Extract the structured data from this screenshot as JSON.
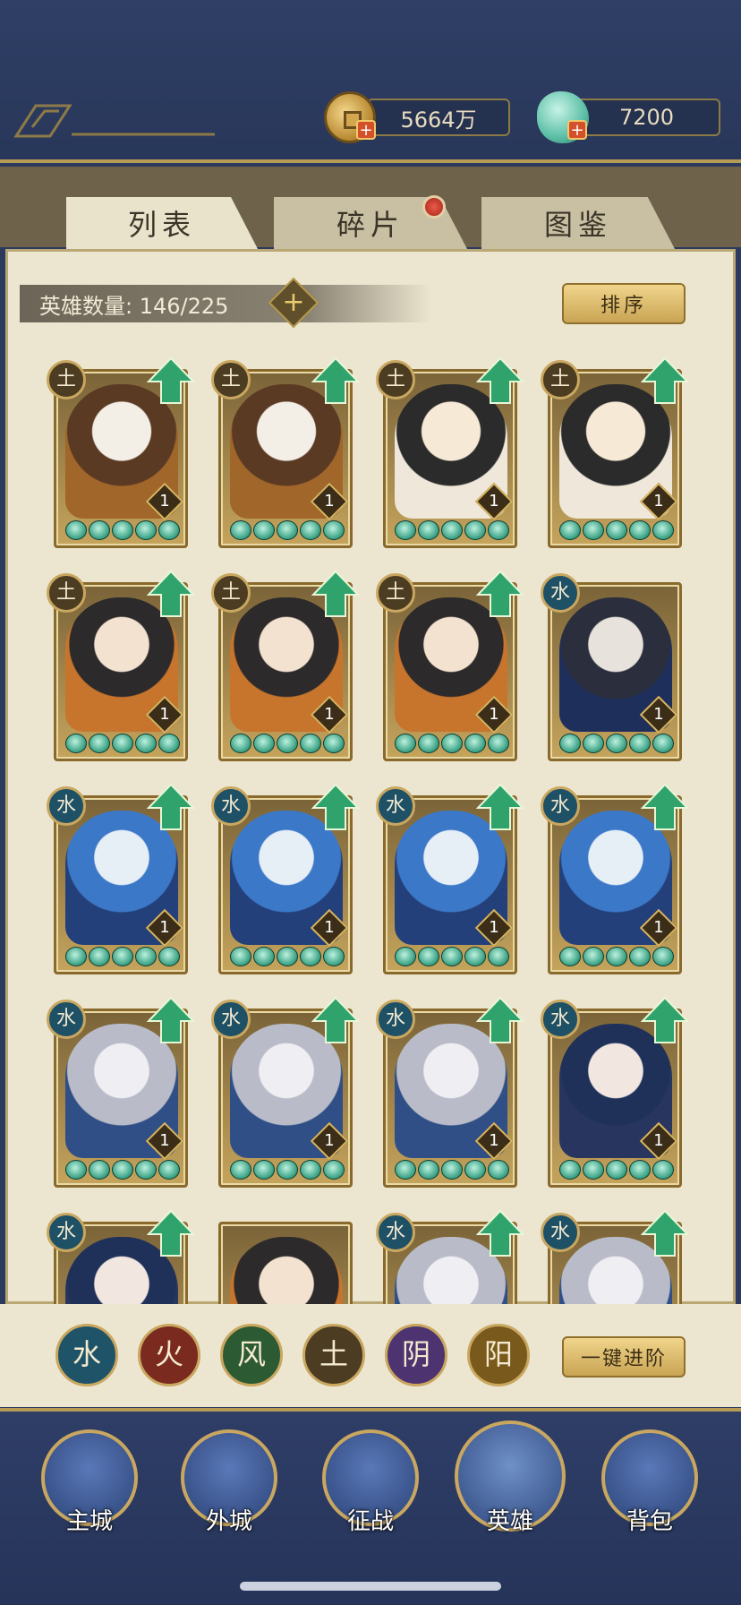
{
  "resources": {
    "gold": "5664万",
    "jade": "7200",
    "plus": "+"
  },
  "tabs": [
    {
      "label": "列表",
      "active": true
    },
    {
      "label": "碎片",
      "active": false,
      "notification": true
    },
    {
      "label": "图鉴",
      "active": false
    }
  ],
  "hero_count_label": "英雄数量: 146/225",
  "hero_count_plus": "+",
  "sort_button": "排序",
  "heroes": [
    {
      "element": "土",
      "level": "1",
      "stars": 5,
      "upgradable": true
    },
    {
      "element": "土",
      "level": "1",
      "stars": 5,
      "upgradable": true
    },
    {
      "element": "土",
      "level": "1",
      "stars": 5,
      "upgradable": true
    },
    {
      "element": "土",
      "level": "1",
      "stars": 5,
      "upgradable": true
    },
    {
      "element": "土",
      "level": "1",
      "stars": 5,
      "upgradable": true
    },
    {
      "element": "土",
      "level": "1",
      "stars": 5,
      "upgradable": true
    },
    {
      "element": "土",
      "level": "1",
      "stars": 5,
      "upgradable": true
    },
    {
      "element": "水",
      "level": "1",
      "stars": 5,
      "upgradable": false
    },
    {
      "element": "水",
      "level": "1",
      "stars": 5,
      "upgradable": true
    },
    {
      "element": "水",
      "level": "1",
      "stars": 5,
      "upgradable": true
    },
    {
      "element": "水",
      "level": "1",
      "stars": 5,
      "upgradable": true
    },
    {
      "element": "水",
      "level": "1",
      "stars": 5,
      "upgradable": true
    },
    {
      "element": "水",
      "level": "1",
      "stars": 5,
      "upgradable": true
    },
    {
      "element": "水",
      "level": "1",
      "stars": 5,
      "upgradable": true
    },
    {
      "element": "水",
      "level": "1",
      "stars": 5,
      "upgradable": true
    },
    {
      "element": "水",
      "level": "1",
      "stars": 5,
      "upgradable": true
    },
    {
      "element": "水",
      "level": "",
      "stars": 0,
      "upgradable": true
    },
    {
      "element": "",
      "level": "",
      "stars": 0,
      "upgradable": false
    },
    {
      "element": "水",
      "level": "",
      "stars": 0,
      "upgradable": true
    },
    {
      "element": "水",
      "level": "",
      "stars": 0,
      "upgradable": true
    }
  ],
  "element_filters": [
    {
      "glyph": "水",
      "color": "#1f5468"
    },
    {
      "glyph": "火",
      "color": "#7a2a1e"
    },
    {
      "glyph": "风",
      "color": "#2c5a33"
    },
    {
      "glyph": "土",
      "color": "#4b3c22"
    },
    {
      "glyph": "阴",
      "color": "#4d3370"
    },
    {
      "glyph": "阳",
      "color": "#7a5a1c"
    }
  ],
  "advance_button": "一键进阶",
  "nav": [
    {
      "label": "主城",
      "active": false
    },
    {
      "label": "外城",
      "active": false
    },
    {
      "label": "征战",
      "active": false
    },
    {
      "label": "英雄",
      "active": true
    },
    {
      "label": "背包",
      "active": false
    }
  ],
  "colors": {
    "panel": "#ece6d0",
    "frame_gold": "#b79a55",
    "nav_blue": "#2f3e67",
    "upgrade_green": "#2fa36b"
  }
}
